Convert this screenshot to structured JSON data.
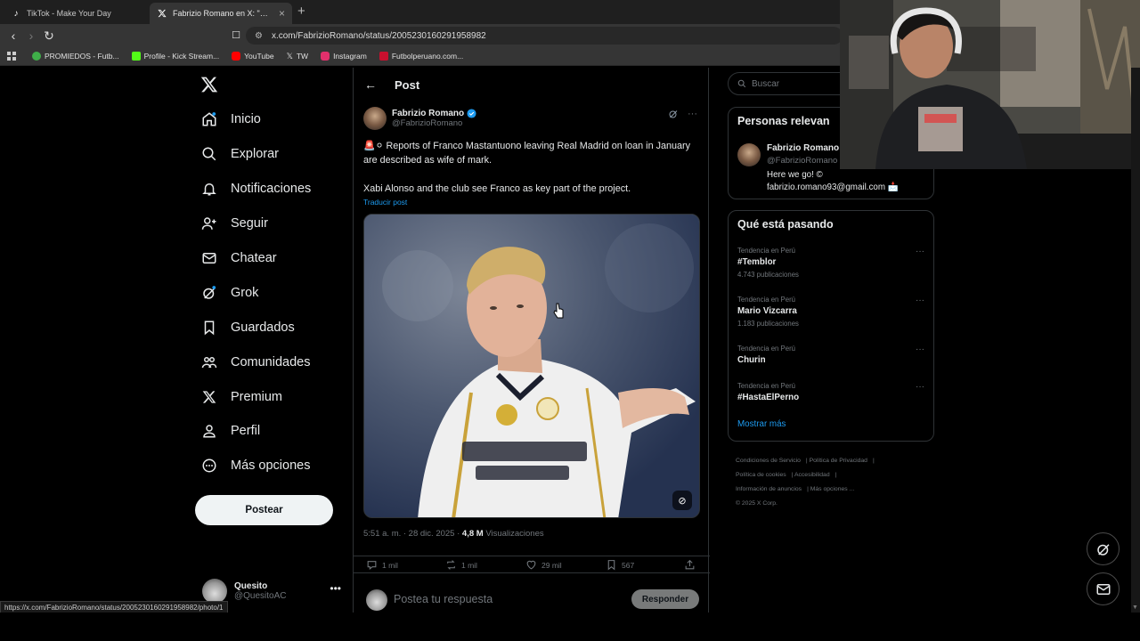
{
  "browser": {
    "tabs": [
      {
        "title": "TikTok - Make Your Day",
        "icon": "tiktok-icon"
      },
      {
        "title": "Fabrizio Romano en X: \"🚨⚪ R",
        "icon": "x-icon"
      }
    ],
    "url": "x.com/FabrizioRomano/status/2005230160291958982",
    "bookmarks": [
      {
        "label": "PROMIEDOS - Futb...",
        "color": "#3fae49"
      },
      {
        "label": "Profile - Kick Stream...",
        "color": "#53fc18"
      },
      {
        "label": "YouTube",
        "color": "#ff0000"
      },
      {
        "label": "TW",
        "color": "#ffffff"
      },
      {
        "label": "Instagram",
        "color": "#e1306c"
      },
      {
        "label": "Futbolperuano.com...",
        "color": "#c8102e"
      }
    ],
    "status_url": "https://x.com/FabrizioRomano/status/2005230160291958982/photo/1"
  },
  "nav": {
    "items": [
      {
        "label": "Inicio",
        "icon": "home-icon"
      },
      {
        "label": "Explorar",
        "icon": "search-icon"
      },
      {
        "label": "Notificaciones",
        "icon": "bell-icon"
      },
      {
        "label": "Seguir",
        "icon": "person-add-icon"
      },
      {
        "label": "Chatear",
        "icon": "mail-icon"
      },
      {
        "label": "Grok",
        "icon": "grok-icon"
      },
      {
        "label": "Guardados",
        "icon": "bookmark-icon"
      },
      {
        "label": "Comunidades",
        "icon": "communities-icon"
      },
      {
        "label": "Premium",
        "icon": "x-premium-icon"
      },
      {
        "label": "Perfil",
        "icon": "profile-icon"
      },
      {
        "label": "Más opciones",
        "icon": "more-circle-icon"
      }
    ],
    "post_button": "Postear",
    "account": {
      "name": "Quesito",
      "handle": "@QuesitoAC"
    }
  },
  "main": {
    "header_title": "Post",
    "tweet": {
      "author_name": "Fabrizio Romano",
      "author_handle": "@FabrizioRomano",
      "text1": "🚨⚪ Reports of Franco Mastantuono leaving Real Madrid on loan in January are described as wife of mark.",
      "text2": "Xabi Alonso and the club see Franco as key part of the project.",
      "translate": "Traducir post",
      "time": "5:51 a. m. · 28 dic. 2025 · ",
      "views": "4,8 M",
      "views_label": "Visualizaciones",
      "stats": {
        "replies": "1 mil",
        "reposts": "1 mil",
        "likes": "29 mil",
        "bookmarks": "567"
      }
    },
    "reply_placeholder": "Postea tu respuesta",
    "reply_button": "Responder"
  },
  "right": {
    "search_placeholder": "Buscar",
    "relevant_title": "Personas relevan",
    "relevant": {
      "name": "Fabrizio Romano",
      "handle": "@FabrizioRomano",
      "bio1": "Here we go! ©",
      "bio2": "fabrizio.romano93@gmail.com 📩"
    },
    "trends_title": "Qué está pasando",
    "trends": [
      {
        "context": "Tendencia en Perú",
        "name": "#Temblor",
        "count": "4.743 publicaciones"
      },
      {
        "context": "Tendencia en Perú",
        "name": "Mario Vizcarra",
        "count": "1.183 publicaciones"
      },
      {
        "context": "Tendencia en Perú",
        "name": "Churin",
        "count": ""
      },
      {
        "context": "Tendencia en Perú",
        "name": "#HastaElPerno",
        "count": ""
      }
    ],
    "show_more": "Mostrar más",
    "footer": [
      "Condiciones de Servicio",
      "Política de Privacidad",
      "Política de cookies",
      "Accesibilidad",
      "Información de anuncios",
      "Más opciones ...",
      "© 2025 X Corp."
    ]
  },
  "colors": {
    "accent": "#1d9bf0",
    "bg": "#000000",
    "border": "#2f3336",
    "muted": "#71767b"
  }
}
